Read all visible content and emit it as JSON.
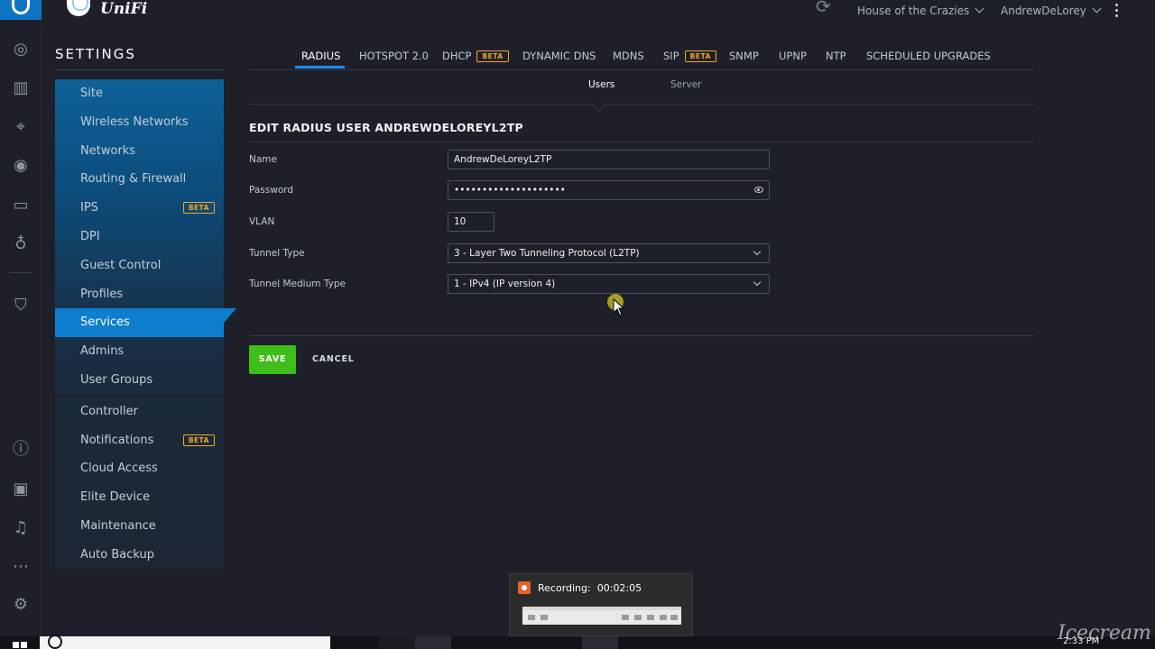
{
  "app": {
    "brand": "UniFi"
  },
  "header": {
    "site_name": "House of the Crazies",
    "username": "AndrewDeLorey"
  },
  "rail": {
    "icons": [
      "dashboard-icon",
      "statistics-icon",
      "map-icon",
      "devices-icon",
      "clients-icon",
      "insights-icon",
      "threat-management-icon",
      "info-icon",
      "events-icon",
      "alerts-icon",
      "chat-icon",
      "settings-icon"
    ]
  },
  "settings": {
    "title": "SETTINGS",
    "beta_label": "BETA",
    "items": [
      {
        "label": "Site"
      },
      {
        "label": "Wireless Networks"
      },
      {
        "label": "Networks"
      },
      {
        "label": "Routing & Firewall"
      },
      {
        "label": "IPS",
        "beta": true
      },
      {
        "label": "DPI"
      },
      {
        "label": "Guest Control"
      },
      {
        "label": "Profiles"
      },
      {
        "label": "Services",
        "active": true
      },
      {
        "label": "Admins"
      },
      {
        "label": "User Groups"
      }
    ],
    "items2": [
      {
        "label": "Controller"
      },
      {
        "label": "Notifications",
        "beta": true
      },
      {
        "label": "Cloud Access"
      },
      {
        "label": "Elite Device"
      },
      {
        "label": "Maintenance"
      },
      {
        "label": "Auto Backup"
      }
    ]
  },
  "tabs": [
    {
      "label": "RADIUS",
      "active": true
    },
    {
      "label": "HOTSPOT 2.0"
    },
    {
      "label": "DHCP",
      "beta": true
    },
    {
      "label": "DYNAMIC DNS"
    },
    {
      "label": "MDNS"
    },
    {
      "label": "SIP",
      "beta": true
    },
    {
      "label": "SNMP"
    },
    {
      "label": "UPNP"
    },
    {
      "label": "NTP"
    },
    {
      "label": "SCHEDULED UPGRADES"
    }
  ],
  "subtabs": [
    {
      "label": "Users",
      "active": true
    },
    {
      "label": "Server"
    }
  ],
  "form": {
    "title": "EDIT RADIUS USER ANDREWDELOREYL2TP",
    "name_label": "Name",
    "name_value": "AndrewDeLoreyL2TP",
    "password_label": "Password",
    "password_value": "••••••••••••••••••••",
    "vlan_label": "VLAN",
    "vlan_value": "10",
    "tunnel_type_label": "Tunnel Type",
    "tunnel_type_value": "3 - Layer Two Tunneling Protocol (L2TP)",
    "tunnel_medium_label": "Tunnel Medium Type",
    "tunnel_medium_value": "1 - IPv4 (IP version 4)",
    "save_label": "SAVE",
    "cancel_label": "CANCEL"
  },
  "recording": {
    "label": "Recording:",
    "time": "00:02:05"
  },
  "taskbar": {
    "time": "2:33 PM",
    "watermark": "Icecream"
  },
  "colors": {
    "accent": "#0e7fce",
    "save": "#3fbd1b",
    "beta": "#f5a623",
    "background": "#1e2029"
  }
}
